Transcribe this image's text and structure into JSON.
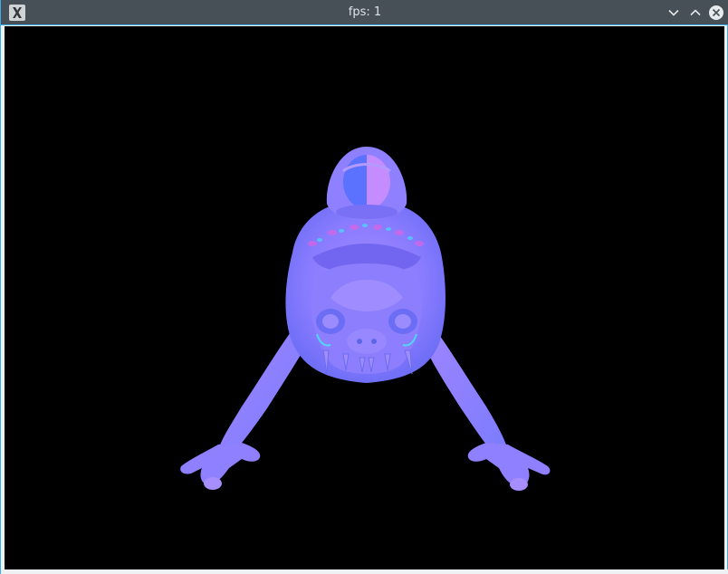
{
  "window": {
    "title": "fps: 1",
    "app_icon": "x11-app-icon",
    "controls": {
      "minimize_icon": "chevron-down-icon",
      "maximize_icon": "chevron-up-icon",
      "close_icon": "close-icon"
    }
  },
  "viewport": {
    "background_color": "#000000",
    "model": "normal-shaded-frog-creature"
  },
  "colors": {
    "titlebar": "#475057",
    "accent_border": "#3daee9",
    "model_base": "#8a7cff",
    "model_highlight": "#b27bff",
    "model_shadow": "#5a6cff",
    "model_cyan": "#4fd9ff",
    "model_magenta": "#e04fd8"
  }
}
